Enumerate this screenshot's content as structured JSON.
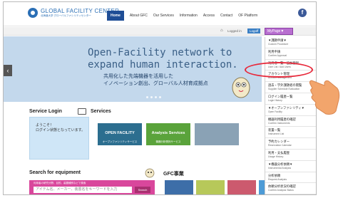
{
  "header": {
    "logo_en": "GLOBAL FACILITY CENTER",
    "logo_jp": "北海道大学 グローバルファシリティセンター",
    "nav": [
      {
        "label": "Home",
        "active": true
      },
      {
        "label": "About GFC"
      },
      {
        "label": "Our Services"
      },
      {
        "label": "Information"
      },
      {
        "label": "Access"
      },
      {
        "label": "Contact"
      },
      {
        "label": "OF Platform"
      }
    ],
    "fb_glyph": "f"
  },
  "loginbar": {
    "home_glyph": "⌂",
    "logged_in": "Logged in",
    "logoff": "Logoff",
    "mypage": "MyPage▼"
  },
  "hero": {
    "title_line1": "Open-Facility network to",
    "title_line2": "expand human interaction.",
    "sub_line1": "共用化した先端機器を活用した",
    "sub_line2": "イノベーション創出、グローバル人材育成拠点",
    "prev_glyph": "‹"
  },
  "service_login": {
    "title": "Service Login",
    "line1": "ようこそ！",
    "line2": "ログイン状態となっています。"
  },
  "services": {
    "title": "Services",
    "cards": [
      {
        "label": "OPEN FACILITY",
        "sub": "オープンファシリティサービス"
      },
      {
        "label": "Analysis Services",
        "sub": "機器分析受託サービス"
      },
      {
        "label": "",
        "sub": ""
      }
    ]
  },
  "search": {
    "title": "Search for equipment",
    "note": "利用者の研究分野、目的、装置種別などで検索",
    "placeholder": "アイテム名、メーカー、装置名をキーワードを入力",
    "button": "Search"
  },
  "gfc": {
    "title": "GFC事業"
  },
  "menu": {
    "items": [
      {
        "jp": "▼課題申請▼",
        "en": "Custom Procedure"
      },
      {
        "jp": "利用申請",
        "en": "Confirm Approval"
      },
      {
        "jp": "利用者一覧・追加登録",
        "en": "User List / Add Users"
      },
      {
        "jp": "アカウント管理",
        "en": "Account Management"
      },
      {
        "jp": "過去・学外課題者の閲覧",
        "en": "Supplier Schedule Evaluation"
      },
      {
        "jp": "ログイン履歴一覧",
        "en": "Login History"
      },
      {
        "jp": "▼オープンファシリティ▼",
        "en": "Open Facility"
      },
      {
        "jp": "機器利用履歴の確認",
        "en": "Confirm Instruments"
      },
      {
        "jp": "装置一覧",
        "en": "Instrument List"
      },
      {
        "jp": "予約カレンダー",
        "en": "Reservation Calendar"
      },
      {
        "jp": "利用・支払履歴",
        "en": "Usage History"
      },
      {
        "jp": "▼機器分析依頼▼",
        "en": "Instrumental Analysis"
      },
      {
        "jp": "分析依頼",
        "en": "Request Analysis"
      },
      {
        "jp": "依頼分析状況の確認",
        "en": "Confirm Analysis Status"
      }
    ]
  }
}
